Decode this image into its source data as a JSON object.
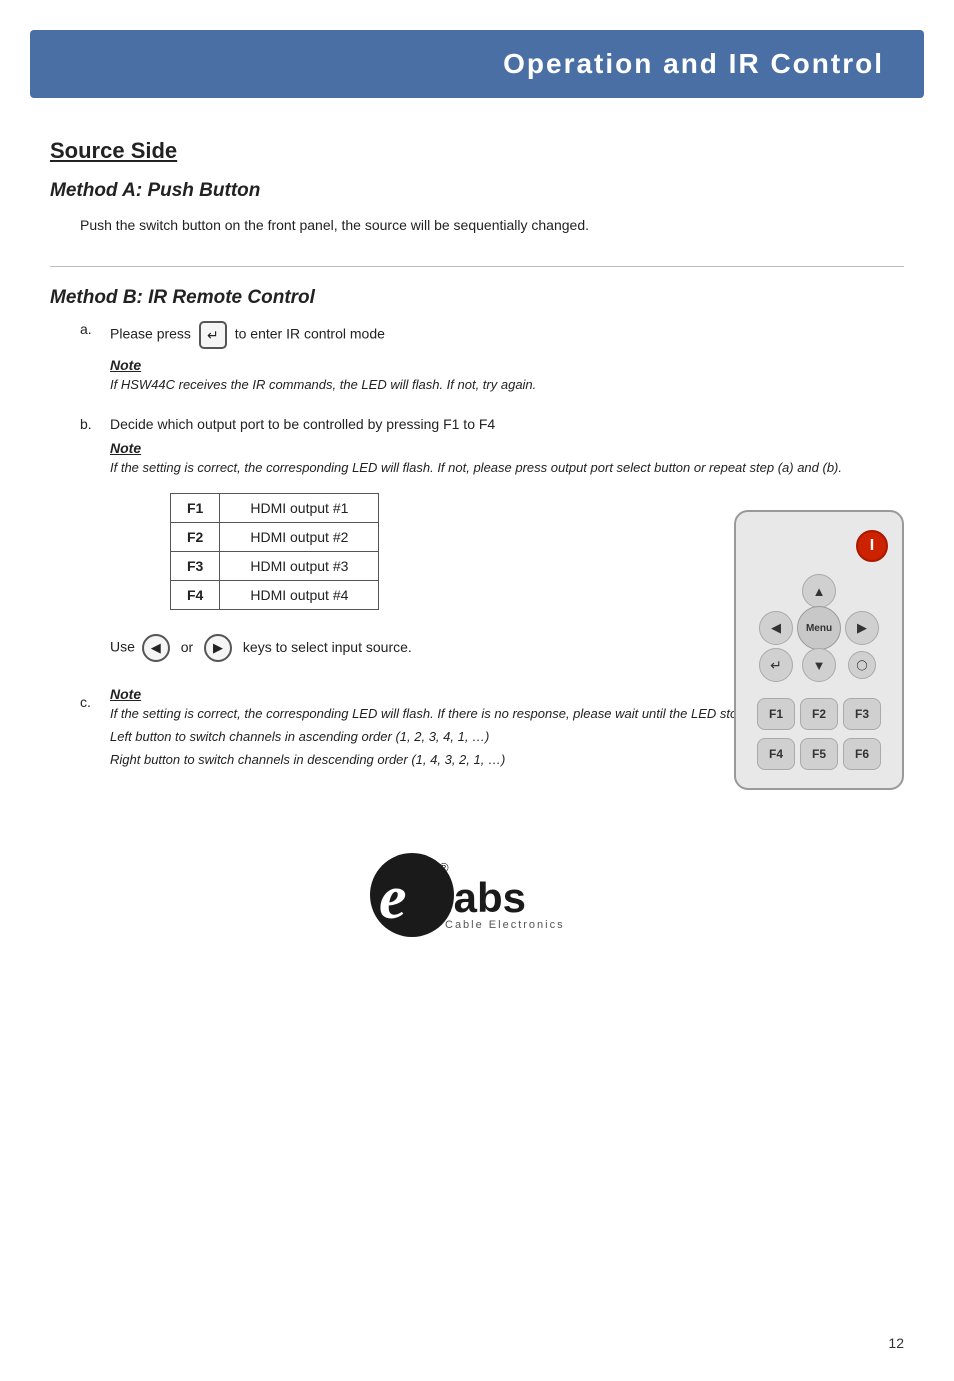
{
  "header": {
    "title": "Operation  and  IR  Control"
  },
  "page": {
    "number": "12"
  },
  "section": {
    "title": "Source Side",
    "method_a": {
      "title": "Method A: Push Button",
      "body": "Push the switch button on the front panel, the source will be sequentially changed."
    },
    "method_b": {
      "title": "Method B: IR Remote Control",
      "step_a": {
        "label": "a.",
        "text": "Please press",
        "text2": "to enter IR control mode",
        "note_label": "Note",
        "note_text": "If HSW44C receives the IR commands, the LED will flash. If not, try again."
      },
      "step_b": {
        "label": "b.",
        "text": "Decide which output port to be controlled by pressing F1 to F4",
        "note_label": "Note",
        "note_text": "If the setting is correct, the corresponding LED will flash. If not, please press output port select button or repeat step (a) and (b).",
        "table": {
          "rows": [
            {
              "key": "F1",
              "value": "HDMI output #1"
            },
            {
              "key": "F2",
              "value": "HDMI output #2"
            },
            {
              "key": "F3",
              "value": "HDMI output #3"
            },
            {
              "key": "F4",
              "value": "HDMI output #4"
            }
          ]
        }
      },
      "step_c": {
        "label": "c.",
        "text_before": "Use",
        "text_middle": "or",
        "text_after": "keys to select input source.",
        "note_label": "Note",
        "note_text_1": "If the setting is correct, the corresponding LED will flash. If there is no response, please wait until the LED stops flashing, and try again.",
        "note_text_2": "Left button to switch channels in ascending order (1, 2, 3, 4, 1, …)",
        "note_text_3": "Right button to switch channels in descending order (1, 4, 3, 2, 1, …)"
      }
    }
  },
  "logo": {
    "e": "e",
    "labs": "labs",
    "sub": "Cable Electronics",
    "registered": "®"
  },
  "remote": {
    "power": "I",
    "up": "▲",
    "down": "▼",
    "left": "◀",
    "right": "▶",
    "menu": "Menu",
    "enter": "↵",
    "small_btn": "◯",
    "f1": "F1",
    "f2": "F2",
    "f3": "F3",
    "f4": "F4",
    "f5": "F5",
    "f6": "F6"
  }
}
